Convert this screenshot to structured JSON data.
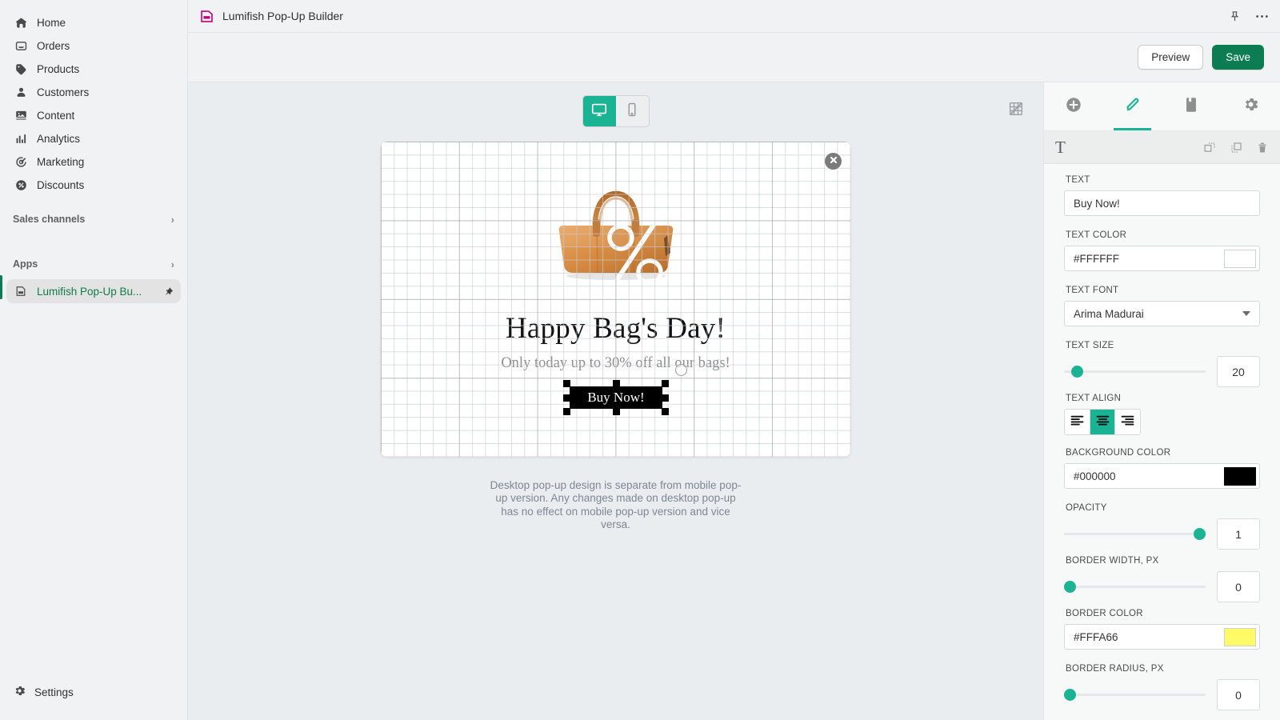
{
  "sidebar": {
    "items": [
      {
        "label": "Home",
        "icon": "home-icon"
      },
      {
        "label": "Orders",
        "icon": "orders-icon"
      },
      {
        "label": "Products",
        "icon": "products-tag-icon"
      },
      {
        "label": "Customers",
        "icon": "customers-person-icon"
      },
      {
        "label": "Content",
        "icon": "content-image-icon"
      },
      {
        "label": "Analytics",
        "icon": "analytics-bars-icon"
      },
      {
        "label": "Marketing",
        "icon": "marketing-target-icon"
      },
      {
        "label": "Discounts",
        "icon": "discounts-percent-icon"
      }
    ],
    "sections": [
      {
        "label": "Sales channels",
        "chevron": "›"
      },
      {
        "label": "Apps",
        "chevron": "›"
      }
    ],
    "active_app": {
      "label": "Lumifish Pop-Up Bu...",
      "icon": "app-icon",
      "pin": "pin-icon"
    },
    "settings": {
      "label": "Settings",
      "icon": "gear-icon"
    }
  },
  "topbar": {
    "app_title": "Lumifish Pop-Up Builder",
    "pin_icon": "pin-icon",
    "more_icon": "more-horizontal-icon"
  },
  "actionbar": {
    "preview_label": "Preview",
    "save_label": "Save"
  },
  "canvas": {
    "device_desktop_icon": "desktop-monitor-icon",
    "device_mobile_icon": "mobile-phone-icon",
    "selected_device": "desktop",
    "grid_toggle_icon": "grid-off-icon",
    "close_icon": "close-circle-icon",
    "popup": {
      "headline": "Happy Bag's Day!",
      "subline": "Only today up to 30% off all our bags!",
      "button_label": "Buy Now!",
      "image": "leather-bag-with-percent-icon"
    },
    "note": "Desktop pop-up design is separate from mobile pop-up version. Any changes made on desktop pop-up has no effect on mobile pop-up version and vice versa."
  },
  "right_panel": {
    "tabs": [
      {
        "name": "add",
        "icon": "plus-circle-icon",
        "active": false
      },
      {
        "name": "edit",
        "icon": "pencil-icon",
        "active": true
      },
      {
        "name": "templates",
        "icon": "bookmark-icon",
        "active": false
      },
      {
        "name": "settings",
        "icon": "gear-icon",
        "active": false
      }
    ],
    "element_bar": {
      "element_type": "T",
      "tools": [
        {
          "name": "send-to-back",
          "icon": "send-to-back-icon"
        },
        {
          "name": "duplicate",
          "icon": "duplicate-icon"
        },
        {
          "name": "delete",
          "icon": "trash-icon"
        }
      ]
    },
    "fields": {
      "text": {
        "label": "TEXT",
        "value": "Buy Now!"
      },
      "text_color": {
        "label": "TEXT COLOR",
        "value": "#FFFFFF",
        "swatch": "#FFFFFF"
      },
      "text_font": {
        "label": "TEXT FONT",
        "value": "Arima Madurai"
      },
      "text_size": {
        "label": "TEXT SIZE",
        "value": "20",
        "knob_pct": 5
      },
      "text_align": {
        "label": "TEXT ALIGN",
        "options": [
          "left",
          "center",
          "right"
        ],
        "selected": "center"
      },
      "background_color": {
        "label": "BACKGROUND COLOR",
        "value": "#000000",
        "swatch": "#000000"
      },
      "opacity": {
        "label": "OPACITY",
        "value": "1",
        "knob_pct": 100
      },
      "border_width": {
        "label": "BORDER WIDTH, PX",
        "value": "0",
        "knob_pct": 0
      },
      "border_color": {
        "label": "BORDER COLOR",
        "value": "#FFFA66",
        "swatch": "#FFFA66"
      },
      "border_radius": {
        "label": "BORDER RADIUS, PX",
        "value": "0",
        "knob_pct": 0
      }
    }
  },
  "colors": {
    "accent_teal": "#1ab394",
    "brand_green": "#0c7d52",
    "app_magenta": "#C3007A"
  }
}
